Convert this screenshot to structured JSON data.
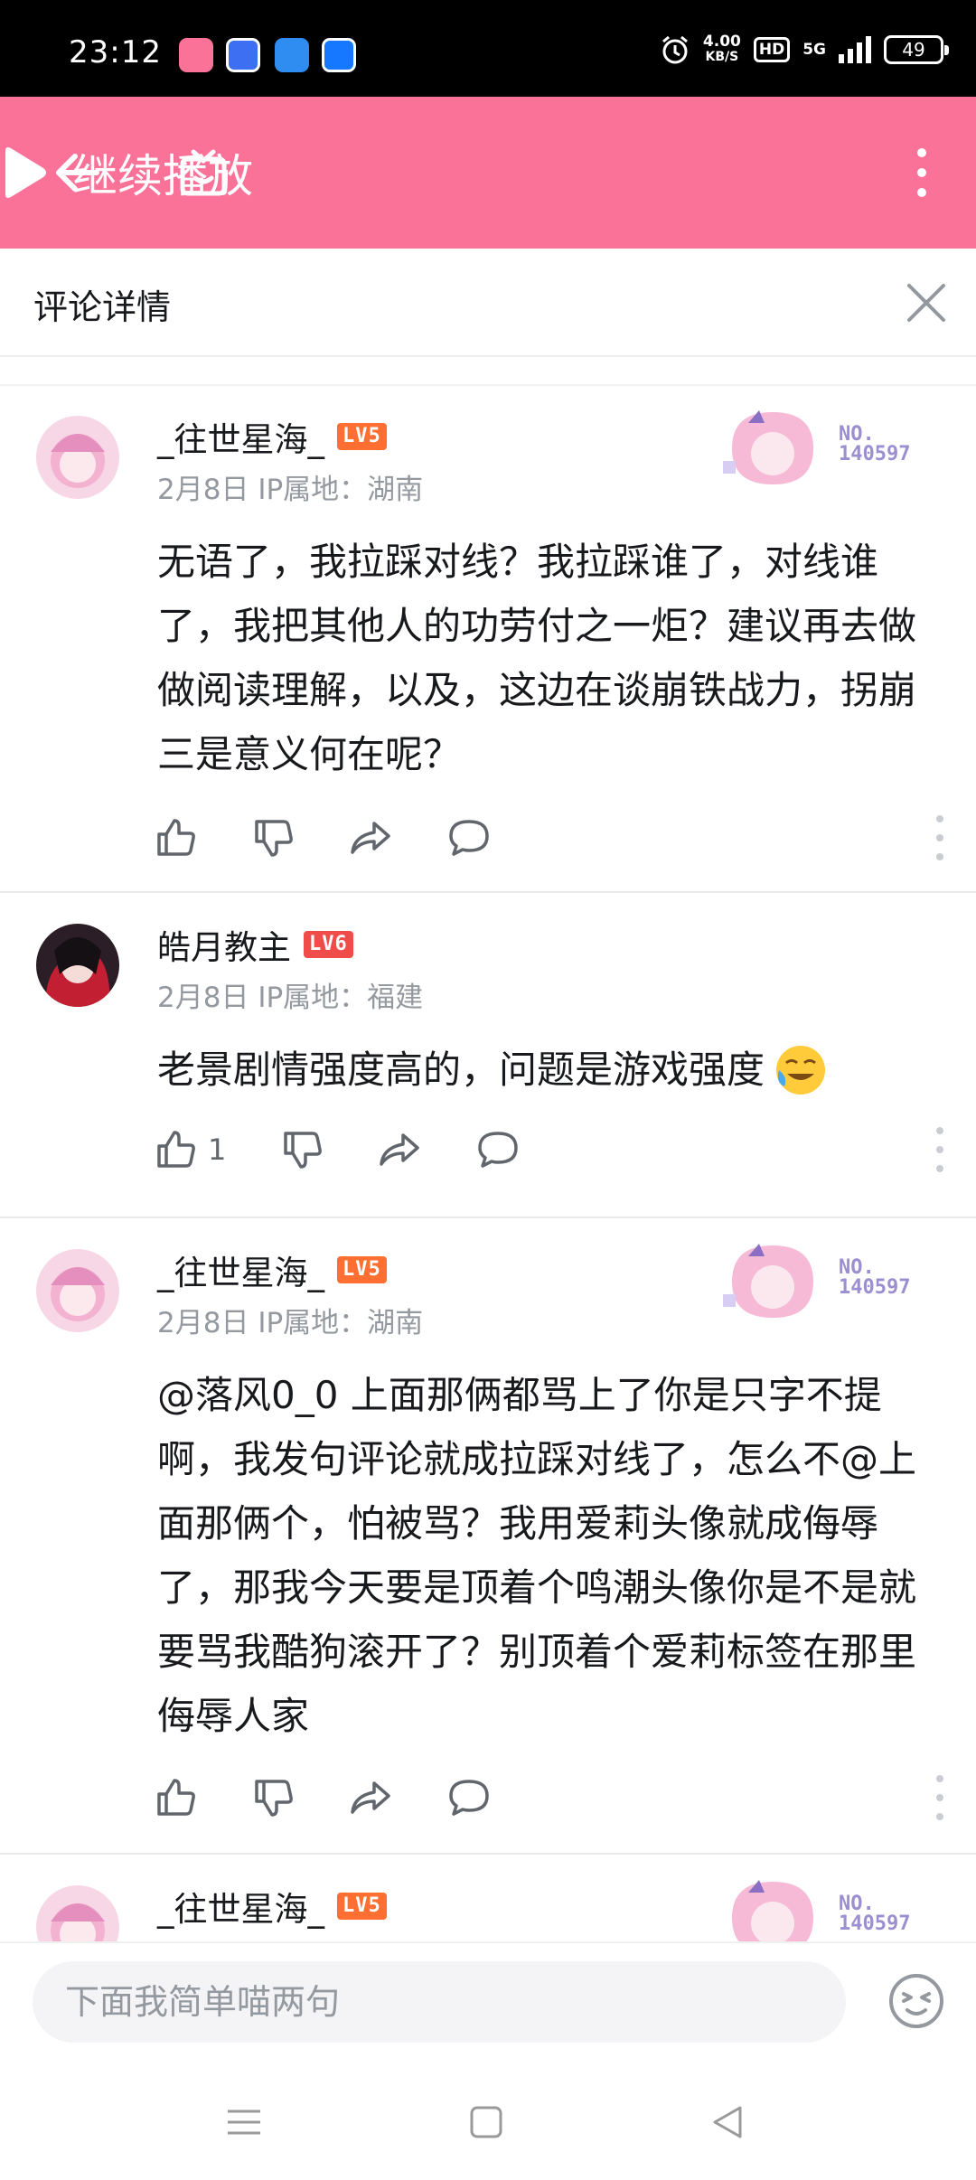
{
  "status_bar": {
    "time": "23:12",
    "net_speed_value": "4.00",
    "net_speed_unit": "KB/S",
    "hd": "HD",
    "network": "5G",
    "battery": "49"
  },
  "header": {
    "back_icon": "arrow-left-icon",
    "home_icon": "tv-home-icon",
    "play_label": "继续播放",
    "more_icon": "vertical-dots-icon",
    "background": "#fb7299"
  },
  "panel": {
    "title": "评论详情",
    "close_icon": "close-icon"
  },
  "comments": [
    {
      "username": "_往世星海_",
      "level": "LV5",
      "date": "2月8日",
      "ip": "IP属地：湖南",
      "badge_no": "NO.",
      "badge_num": "140597",
      "content": "无语了，我拉踩对线？我拉踩谁了，对线谁了，我把其他人的功劳付之一炬？建议再去做做阅读理解，以及，这边在谈崩铁战力，拐崩三是意义何在呢？",
      "like_count": ""
    },
    {
      "username": "皓月教主",
      "level": "LV6",
      "date": "2月8日",
      "ip": "IP属地：福建",
      "content": "老景剧情强度高的，问题是游戏强度",
      "like_count": "1"
    },
    {
      "username": "_往世星海_",
      "level": "LV5",
      "date": "2月8日",
      "ip": "IP属地：湖南",
      "badge_no": "NO.",
      "badge_num": "140597",
      "content": "@落风0_0 上面那俩都骂上了你是只字不提啊，我发句评论就成拉踩对线了，怎么不@上面那俩个，怕被骂？我用爱莉头像就成侮辱了，那我今天要是顶着个鸣潮头像你是不是就要骂我酷狗滚开了？别顶着个爱莉标签在那里侮辱人家",
      "like_count": ""
    },
    {
      "username": "_往世星海_",
      "level": "LV5",
      "badge_no": "NO.",
      "badge_num": "140597"
    }
  ],
  "input": {
    "placeholder": "下面我简单喵两句",
    "emoji_icon": "emoji-face-icon"
  },
  "nav": {
    "menu_icon": "menu-icon",
    "home_icon": "square-home-icon",
    "back_icon": "triangle-back-icon"
  }
}
